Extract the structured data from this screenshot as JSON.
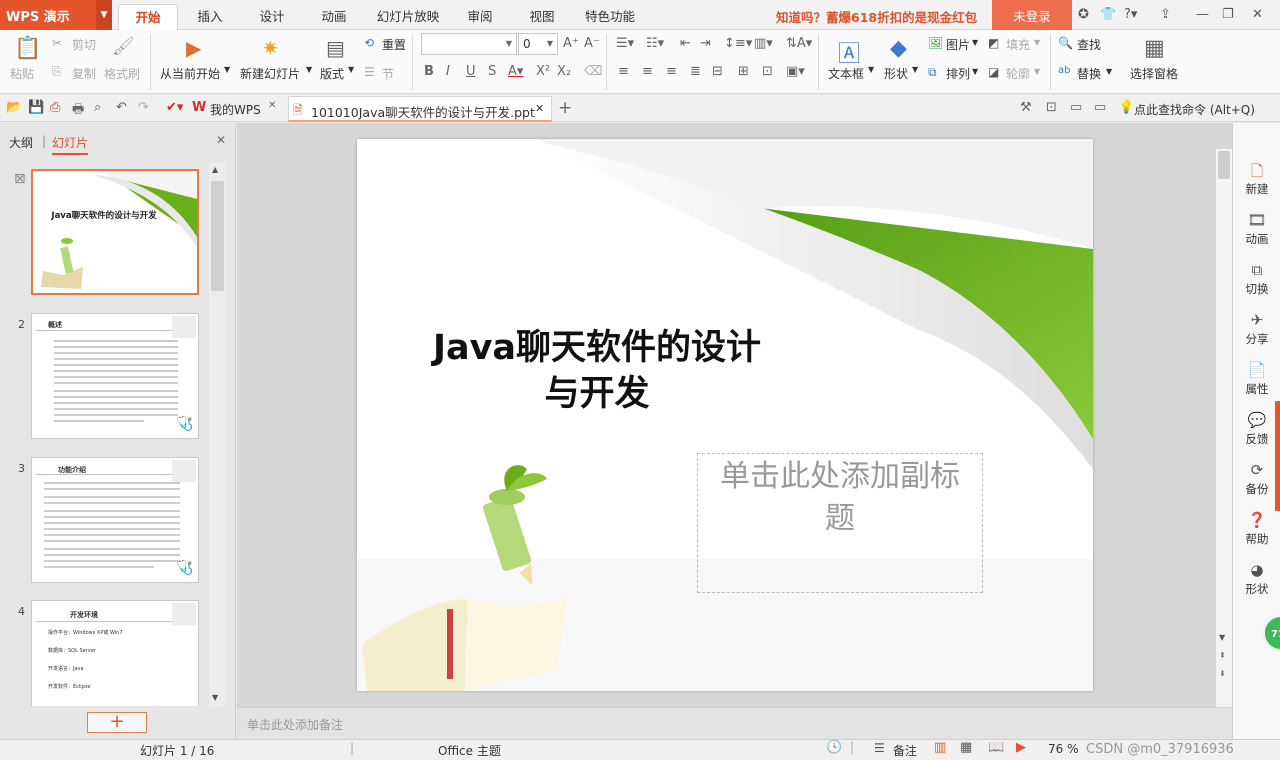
{
  "app": {
    "logo": "WPS 演示",
    "tabs": [
      "开始",
      "插入",
      "设计",
      "动画",
      "幻灯片放映",
      "审阅",
      "视图",
      "特色功能"
    ],
    "promo": "知道吗？蓄爆618折扣的是现金红包",
    "login": "未登录"
  },
  "ribbon": {
    "paste": "粘贴",
    "cut": "剪切",
    "copy": "复制",
    "format_painter": "格式刷",
    "from_current": "从当前开始",
    "new_slide": "新建幻灯片",
    "layout": "版式",
    "reset": "重置",
    "section": "节",
    "font_size": "0",
    "textbox": "文本框",
    "shape": "形状",
    "picture": "图片",
    "arrange": "排列",
    "fill": "填充",
    "outline": "轮廓",
    "find": "查找",
    "replace": "替换",
    "selection_pane": "选择窗格"
  },
  "tabbar": {
    "my_wps": "我的WPS",
    "doc_name": "101010Java聊天软件的设计与开发.ppt",
    "command_search": "点此查找命令 (Alt+Q)"
  },
  "left_panel": {
    "tab_outline": "大纲",
    "tab_slides": "幻灯片",
    "thumbs": [
      {
        "num": "",
        "title": "Java聊天软件的设计与开发"
      },
      {
        "num": "2",
        "title": "概述"
      },
      {
        "num": "3",
        "title": "功能介绍"
      },
      {
        "num": "4",
        "title": "开发环境",
        "lines": [
          "操作平台：Windows XP或 Win7",
          "数据库：SQL Server",
          "开发语言：Java",
          "开发软件：Eclipse"
        ]
      }
    ]
  },
  "slide": {
    "title_line1": "Java聊天软件的设计",
    "title_line2": "与开发",
    "subtitle_line1": "单击此处添加副标",
    "subtitle_line2": "题"
  },
  "notes_placeholder": "单击此处添加备注",
  "sidebar": [
    "新建",
    "动画",
    "切换",
    "分享",
    "属性",
    "反馈",
    "备份",
    "帮助",
    "形状"
  ],
  "status": {
    "slide_counter": "幻灯片 1 / 16",
    "theme": "Office 主题",
    "notes": "备注",
    "zoom": "76 %",
    "watermark": "CSDN @m0_37916936",
    "float_badge": "71"
  },
  "colors": {
    "accent": "#e4552b",
    "promo": "#e0542a",
    "green": "#6aae1c"
  }
}
